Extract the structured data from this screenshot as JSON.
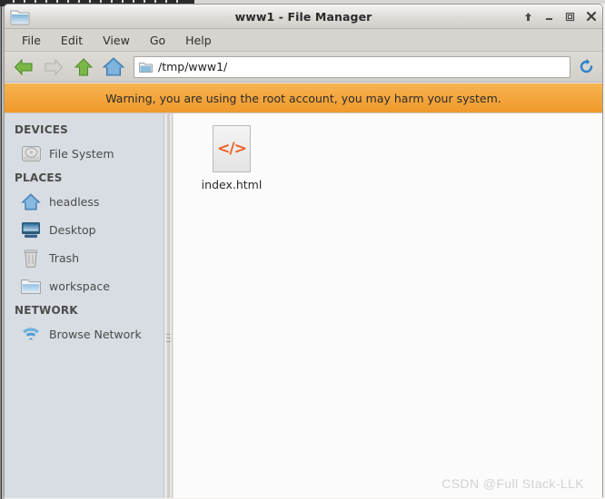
{
  "window": {
    "title": "www1 - File Manager",
    "icon": "folder-icon",
    "buttons": {
      "shade_label": "⬆",
      "minimize_label": "▁",
      "maximize_label": "❐",
      "close_label": "✕"
    }
  },
  "menubar": {
    "items": [
      {
        "label": "File"
      },
      {
        "label": "Edit"
      },
      {
        "label": "View"
      },
      {
        "label": "Go"
      },
      {
        "label": "Help"
      }
    ]
  },
  "toolbar": {
    "back_icon": "arrow-left-icon",
    "forward_icon": "arrow-right-icon",
    "up_icon": "arrow-up-icon",
    "home_icon": "home-icon",
    "path_icon": "folder-icon",
    "path_value": "/tmp/www1/",
    "reload_icon": "reload-icon"
  },
  "warning": {
    "text": "Warning, you are using the root account, you may harm your system.",
    "background": "#f0992c"
  },
  "sidebar": {
    "sections": [
      {
        "heading": "DEVICES",
        "items": [
          {
            "label": "File System",
            "icon": "harddisk-icon"
          }
        ]
      },
      {
        "heading": "PLACES",
        "items": [
          {
            "label": "headless",
            "icon": "home-icon"
          },
          {
            "label": "Desktop",
            "icon": "monitor-icon"
          },
          {
            "label": "Trash",
            "icon": "trash-icon"
          },
          {
            "label": "workspace",
            "icon": "folder-icon"
          }
        ]
      },
      {
        "heading": "NETWORK",
        "items": [
          {
            "label": "Browse Network",
            "icon": "network-wifi-icon"
          }
        ]
      }
    ]
  },
  "content": {
    "files": [
      {
        "name": "index.html",
        "icon": "html-file-icon",
        "glyph": "</>",
        "glyph_color": "#ef5f23"
      }
    ]
  },
  "watermark": {
    "text": "CSDN @Full Stack-LLK"
  }
}
